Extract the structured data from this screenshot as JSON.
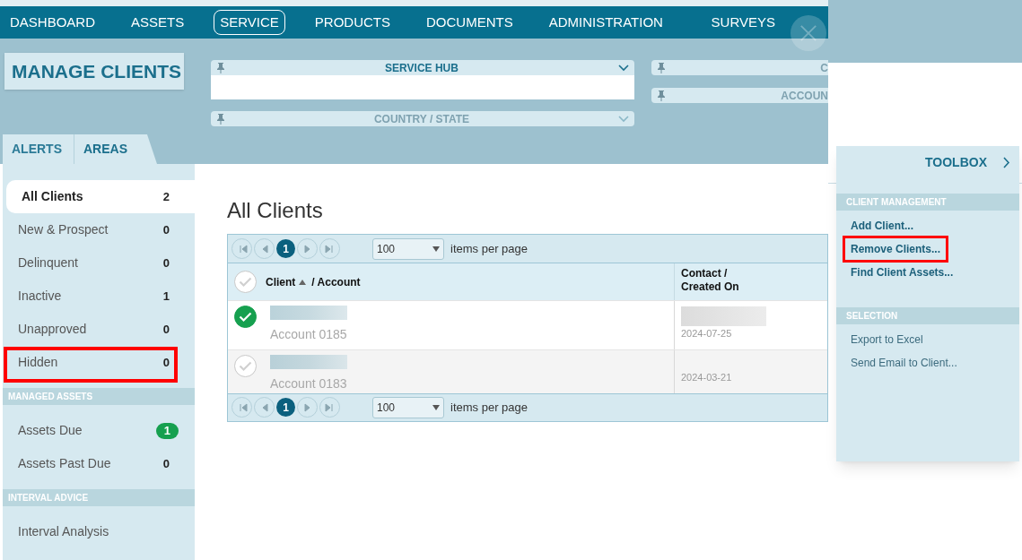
{
  "nav": [
    {
      "label": "DASHBOARD",
      "selected": false
    },
    {
      "label": "ASSETS",
      "selected": false
    },
    {
      "label": "SERVICE",
      "selected": true
    },
    {
      "label": "PRODUCTS",
      "selected": false
    },
    {
      "label": "DOCUMENTS",
      "selected": false
    },
    {
      "label": "ADMINISTRATION",
      "selected": false
    },
    {
      "label": "SURVEYS",
      "selected": false
    }
  ],
  "page_title": "MANAGE CLIENTS",
  "filters": [
    {
      "label": "SERVICE HUB",
      "disabled": false,
      "expanded": true
    },
    {
      "label": "COUNTRY / STATE",
      "disabled": true,
      "expanded": false
    }
  ],
  "filters_right": [
    {
      "label": "C"
    },
    {
      "label": "ACCOUN"
    }
  ],
  "side_tabs": [
    {
      "label": "ALERTS",
      "selected": false
    },
    {
      "label": "AREAS",
      "selected": true
    }
  ],
  "sidebar": [
    {
      "items": [
        {
          "label": "All Clients",
          "count": "2",
          "selected": true,
          "kind": "plain",
          "highlighted": false
        },
        {
          "label": "New & Prospect",
          "count": "0",
          "selected": false,
          "kind": "plain",
          "highlighted": false
        },
        {
          "label": "Delinquent",
          "count": "0",
          "selected": false,
          "kind": "plain",
          "highlighted": false
        },
        {
          "label": "Inactive",
          "count": "1",
          "selected": false,
          "kind": "plain",
          "highlighted": false
        },
        {
          "label": "Unapproved",
          "count": "0",
          "selected": false,
          "kind": "plain",
          "highlighted": false
        },
        {
          "label": "Hidden",
          "count": "0",
          "selected": false,
          "kind": "plain",
          "highlighted": true
        }
      ]
    },
    {
      "heading": "MANAGED ASSETS",
      "items": [
        {
          "label": "Assets Due",
          "count": "1",
          "selected": false,
          "kind": "badge",
          "highlighted": false
        },
        {
          "label": "Assets Past Due",
          "count": "0",
          "selected": false,
          "kind": "plain",
          "highlighted": false
        }
      ]
    },
    {
      "heading": "INTERVAL ADVICE",
      "items": [
        {
          "label": "Interval Analysis",
          "selected": false,
          "kind": "plain",
          "highlighted": false
        }
      ]
    }
  ],
  "content_title": "All Clients",
  "pagers": [
    {
      "page": "1",
      "per_page": "100",
      "label": "items per page"
    },
    {
      "page": "1",
      "per_page": "100",
      "label": "items per page"
    }
  ],
  "table": {
    "select_all": false,
    "columns": [
      {
        "label": "Client",
        "sorted": true,
        "suffix": "/ Account"
      },
      {
        "label": "Contact / Created On"
      }
    ],
    "rows": [
      {
        "selected": true,
        "account": "Account 0185",
        "created_on": "2024-07-25"
      },
      {
        "selected": false,
        "account": "Account 0183",
        "created_on": "2024-03-21"
      }
    ]
  },
  "toolbox": {
    "title": "TOOLBOX",
    "sections": [
      {
        "heading": "CLIENT MANAGEMENT",
        "items": [
          {
            "label": "Add Client...",
            "bold": true,
            "highlighted": false
          },
          {
            "label": "Remove Clients...",
            "bold": true,
            "highlighted": true
          },
          {
            "label": "Find Client Assets...",
            "bold": true,
            "highlighted": false
          }
        ]
      },
      {
        "heading": "SELECTION",
        "items": [
          {
            "label": "Export to Excel",
            "bold": false,
            "highlighted": false
          },
          {
            "label": "Send Email to Client...",
            "bold": false,
            "highlighted": false
          }
        ]
      }
    ]
  }
}
